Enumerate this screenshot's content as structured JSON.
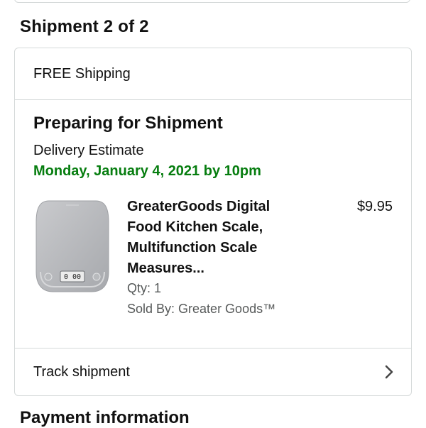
{
  "shipment": {
    "section_title": "Shipment 2 of 2",
    "shipping_label": "FREE Shipping",
    "status": "Preparing for Shipment",
    "estimate_label": "Delivery Estimate",
    "estimate_date": "Monday, January 4, 2021 by 10pm",
    "status_color": "#067d0f",
    "item": {
      "name": "GreaterGoods Digital Food Kitchen Scale, Multifunction Scale Measures...",
      "price": "$9.95",
      "qty": "Qty: 1",
      "seller": "Sold By: Greater Goods™",
      "display_reading": "0 00",
      "icon": "kitchen-scale-image"
    },
    "track_label": "Track shipment",
    "track_icon": "chevron-right-icon"
  },
  "next_section": {
    "title": "Payment information"
  }
}
